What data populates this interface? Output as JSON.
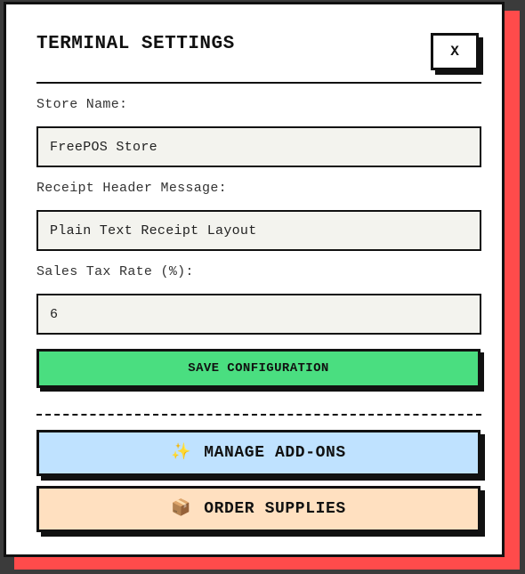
{
  "modal": {
    "title": "TERMINAL SETTINGS",
    "close_label": "X"
  },
  "form": {
    "store_name": {
      "label": "Store Name:",
      "value": "FreePOS Store"
    },
    "receipt_header": {
      "label": "Receipt Header Message:",
      "value": "Plain Text Receipt Layout"
    },
    "sales_tax": {
      "label": "Sales Tax Rate (%):",
      "value": "6"
    },
    "save_label": "SAVE CONFIGURATION"
  },
  "actions": {
    "manage_addons": {
      "icon": "sparkles-icon",
      "icon_glyph": "✨",
      "label": "MANAGE ADD-ONS"
    },
    "order_supplies": {
      "icon": "package-icon",
      "icon_glyph": "📦",
      "label": "ORDER SUPPLIES"
    }
  },
  "colors": {
    "modal_shadow": "#ff4b4b",
    "save_button": "#4ade80",
    "addons_button": "#bfe2ff",
    "supplies_button": "#ffe0c0",
    "field_background": "#f3f3ee"
  }
}
